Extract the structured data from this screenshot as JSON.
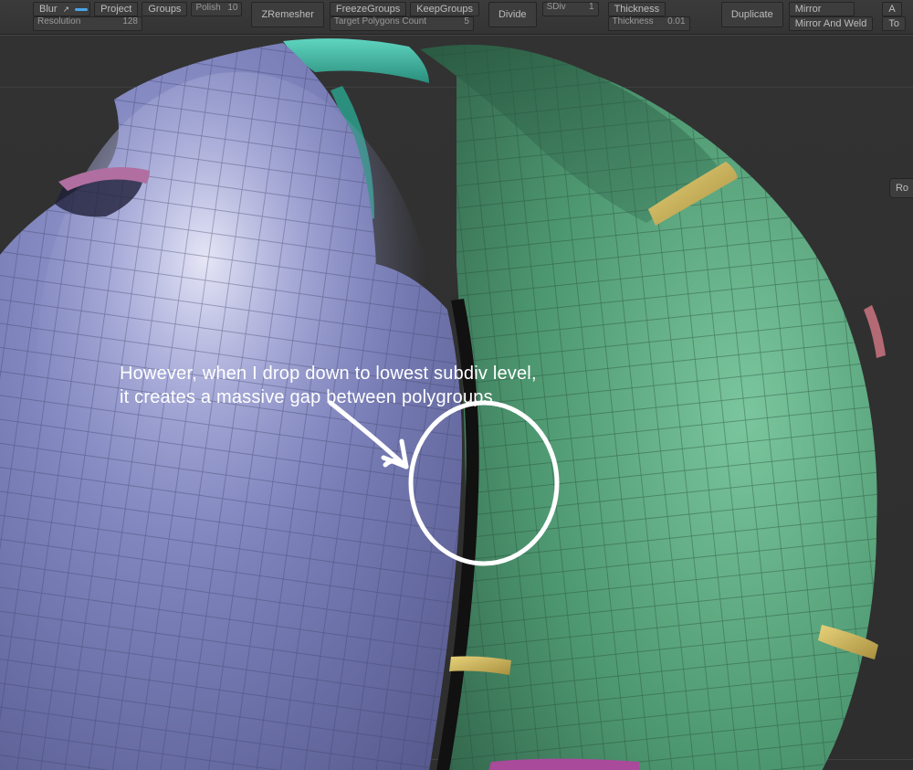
{
  "toolbar": {
    "blur": {
      "label": "Blur",
      "icon": "↗"
    },
    "project": "Project",
    "groups": "Groups",
    "polish": {
      "label": "Polish",
      "value": "10"
    },
    "resolution": {
      "label": "Resolution",
      "value": "128",
      "fill": 22
    },
    "zremesher": "ZRemesher",
    "freeze": "FreezeGroups",
    "keep": "KeepGroups",
    "target": {
      "label": "Target Polygons Count",
      "value": "5",
      "fill": 18
    },
    "divide": "Divide",
    "sdiv": {
      "label": "SDiv",
      "value": "1",
      "fill": 8
    },
    "thickness_label": "Thickness",
    "thickness": {
      "label": "Thickness",
      "value": "0.01",
      "fill": 12
    },
    "duplicate": "Duplicate",
    "mirror": "Mirror",
    "mirror_weld": "Mirror And Weld",
    "a": "A",
    "to": "To"
  },
  "side": {
    "label": "Ro"
  },
  "annotation": {
    "line1": "However, when I drop down to lowest subdiv level,",
    "line2": "it creates a massive gap between polygroups"
  },
  "mesh": {
    "polygroups": [
      "front-purple",
      "side-green",
      "strap-yellow",
      "under-magenta",
      "trim-teal",
      "back-rose"
    ]
  }
}
